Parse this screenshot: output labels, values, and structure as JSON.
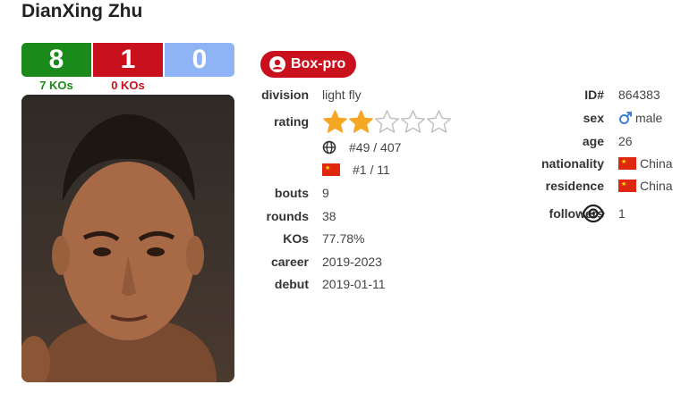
{
  "boxer": {
    "name": "DianXing Zhu",
    "record": {
      "wins": "8",
      "losses": "1",
      "draws": "0"
    },
    "wins_kos": "7 KOs",
    "losses_kos": "0 KOs",
    "badge": "Box-pro"
  },
  "details": {
    "division": {
      "label": "division",
      "value": "light fly"
    },
    "rating": {
      "label": "rating",
      "stars_filled": 2,
      "stars_total": 5
    },
    "world_rank": "#49 / 407",
    "country_rank": "#1 / 11",
    "bouts": {
      "label": "bouts",
      "value": "9"
    },
    "rounds": {
      "label": "rounds",
      "value": "38"
    },
    "kos": {
      "label": "KOs",
      "value": "77.78%"
    },
    "career": {
      "label": "career",
      "value": "2019-2023"
    },
    "debut": {
      "label": "debut",
      "value": "2019-01-11"
    }
  },
  "profile": {
    "id": {
      "label": "ID#",
      "value": "864383"
    },
    "sex": {
      "label": "sex",
      "value": "male"
    },
    "age": {
      "label": "age",
      "value": "26"
    },
    "nationality": {
      "label": "nationality",
      "value": "China"
    },
    "residence": {
      "label": "residence",
      "value": "China"
    },
    "followers": {
      "label": "followers",
      "value": "1"
    }
  },
  "colors": {
    "win": "#1a8a1a",
    "loss": "#c8111c",
    "draw": "#8fb4f5",
    "star": "#f5a623",
    "accent": "#c8111c"
  }
}
